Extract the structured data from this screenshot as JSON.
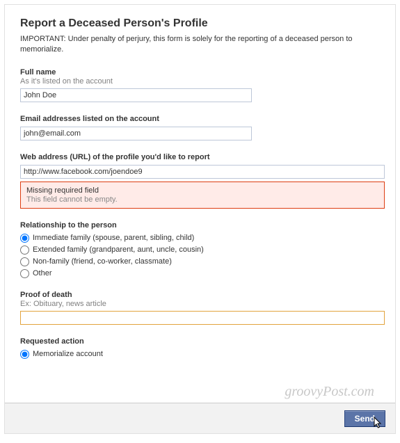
{
  "page": {
    "title": "Report a Deceased Person's Profile",
    "notice": "IMPORTANT: Under penalty of perjury, this form is solely for the reporting of a deceased person to memorialize."
  },
  "fields": {
    "fullName": {
      "label": "Full name",
      "hint": "As it's listed on the account",
      "value": "John Doe"
    },
    "email": {
      "label": "Email addresses listed on the account",
      "value": "john@email.com"
    },
    "url": {
      "label": "Web address (URL) of the profile you'd like to report",
      "value": "http://www.facebook.com/joendoe9"
    },
    "error": {
      "title": "Missing required field",
      "text": "This field cannot be empty."
    },
    "relationship": {
      "label": "Relationship to the person",
      "options": {
        "immediate": "Immediate family (spouse, parent, sibling, child)",
        "extended": "Extended family (grandparent, aunt, uncle, cousin)",
        "nonfamily": "Non-family (friend, co-worker, classmate)",
        "other": "Other"
      }
    },
    "proof": {
      "label": "Proof of death",
      "hint": "Ex: Obituary, news article",
      "value": ""
    },
    "action": {
      "label": "Requested action",
      "options": {
        "memorialize": "Memorialize account"
      }
    }
  },
  "footer": {
    "send": "Send"
  },
  "watermark": "groovyPost.com"
}
